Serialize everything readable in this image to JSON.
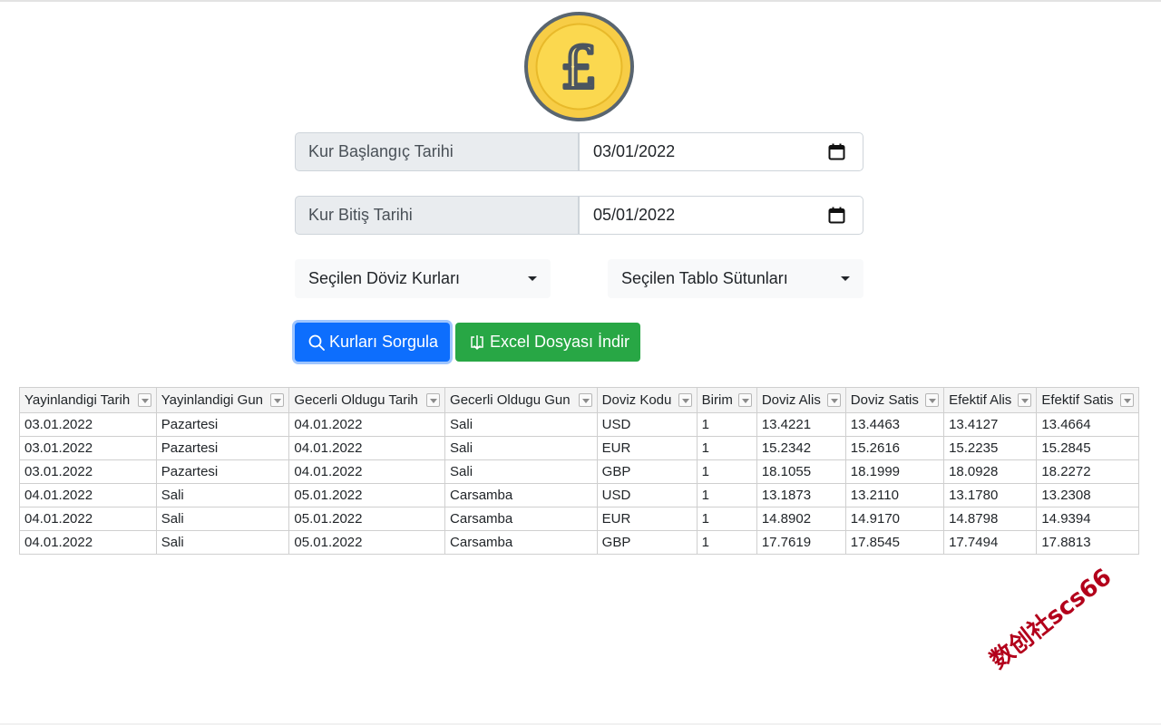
{
  "form": {
    "start_label": "Kur Başlangıç Tarihi",
    "start_value": "03/01/2022",
    "end_label": "Kur Bitiş Tarihi",
    "end_value": "05/01/2022",
    "currency_dropdown": "Seçilen Döviz Kurları",
    "columns_dropdown": "Seçilen Tablo Sütunları"
  },
  "buttons": {
    "query_label": "Kurları Sorgula",
    "excel_label": "Excel Dosyası İndir"
  },
  "colors": {
    "primary": "#0d6efd",
    "success": "#28a745",
    "coin": "#f7cd46",
    "watermark": "#b3001b"
  },
  "table": {
    "headers": [
      "Yayinlandigi Tarih",
      "Yayinlandigi Gun",
      "Gecerli Oldugu Tarih",
      "Gecerli Oldugu Gun",
      "Doviz Kodu",
      "Birim",
      "Doviz Alis",
      "Doviz Satis",
      "Efektif Alis",
      "Efektif Satis"
    ],
    "rows": [
      [
        "03.01.2022",
        "Pazartesi",
        "04.01.2022",
        "Sali",
        "USD",
        "1",
        "13.4221",
        "13.4463",
        "13.4127",
        "13.4664"
      ],
      [
        "03.01.2022",
        "Pazartesi",
        "04.01.2022",
        "Sali",
        "EUR",
        "1",
        "15.2342",
        "15.2616",
        "15.2235",
        "15.2845"
      ],
      [
        "03.01.2022",
        "Pazartesi",
        "04.01.2022",
        "Sali",
        "GBP",
        "1",
        "18.1055",
        "18.1999",
        "18.0928",
        "18.2272"
      ],
      [
        "04.01.2022",
        "Sali",
        "05.01.2022",
        "Carsamba",
        "USD",
        "1",
        "13.1873",
        "13.2110",
        "13.1780",
        "13.2308"
      ],
      [
        "04.01.2022",
        "Sali",
        "05.01.2022",
        "Carsamba",
        "EUR",
        "1",
        "14.8902",
        "14.9170",
        "14.8798",
        "14.9394"
      ],
      [
        "04.01.2022",
        "Sali",
        "05.01.2022",
        "Carsamba",
        "GBP",
        "1",
        "17.7619",
        "17.8545",
        "17.7494",
        "17.8813"
      ]
    ]
  },
  "watermark": "数创社scs66",
  "icons": {
    "logo": "pound-coin-icon",
    "calendar": "calendar-icon",
    "search": "search-icon",
    "download": "download-icon"
  }
}
